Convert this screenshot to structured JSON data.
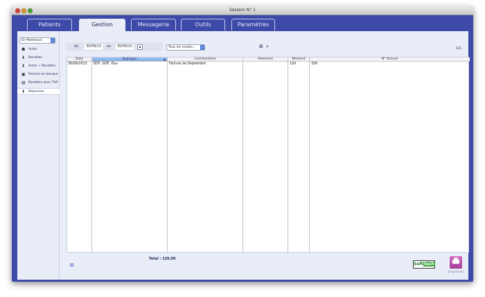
{
  "window": {
    "title": "Session N° 1"
  },
  "tabs": [
    {
      "label": "Patients"
    },
    {
      "label": "Gestion"
    },
    {
      "label": "Messagerie"
    },
    {
      "label": "Outils"
    },
    {
      "label": "Paramètres"
    }
  ],
  "sidebar": {
    "doctor_select": "Dr Medimust",
    "items": [
      {
        "label": "Actes",
        "icon": "stethoscope-icon"
      },
      {
        "label": "Recettes",
        "icon": "income-arrow-icon"
      },
      {
        "label": "Actes + Recettes",
        "icon": "combined-icon"
      },
      {
        "label": "Remise en banque",
        "icon": "bank-deposit-icon"
      },
      {
        "label": "Recettes avec TVA",
        "icon": "tax-sheet-icon"
      },
      {
        "label": "Dépenses",
        "icon": "expense-arrow-icon",
        "active": true
      }
    ]
  },
  "filter": {
    "from_label": "du",
    "from_date": "30/09/13",
    "to_label": "au",
    "to_date": "30/09/13",
    "mode_select": "Tous les modes..."
  },
  "page_indicator": "1/1",
  "table": {
    "columns": [
      "Date",
      "Rubrique",
      "Commentaire",
      "Paiement",
      "Montant",
      "N° facture"
    ],
    "rows": [
      {
        "date": "30/09/2013",
        "rubrique": "EDF, GDF, Eau",
        "commentaire": "Facture de Septembre",
        "paiement": "",
        "montant": "120",
        "facture": "326"
      }
    ]
  },
  "total": "Total : 120,00",
  "footer": {
    "logo_text_left": "Soft",
    "logo_text_right": "tech",
    "print_label": "Imprimer"
  }
}
